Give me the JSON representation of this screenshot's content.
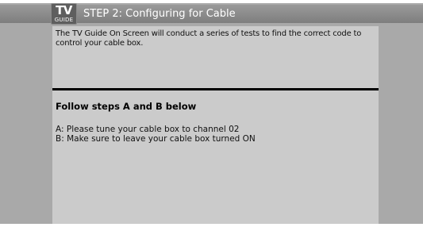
{
  "logo": {
    "line1": "TV",
    "line2": "GUIDE"
  },
  "title": "STEP 2: Configuring for Cable",
  "intro_text": "The TV Guide On Screen will conduct a series of tests to find the correct code to control your cable box.",
  "instructions": {
    "heading": "Follow steps A and B below",
    "steps": [
      "A:  Please tune your cable box to channel 02",
      "B:  Make sure to leave your cable box turned ON"
    ]
  },
  "colors": {
    "background": "#a9a9a9",
    "panel": "#cbcbcb",
    "title_bar": "#8a8a8a",
    "divider": "#000000"
  }
}
